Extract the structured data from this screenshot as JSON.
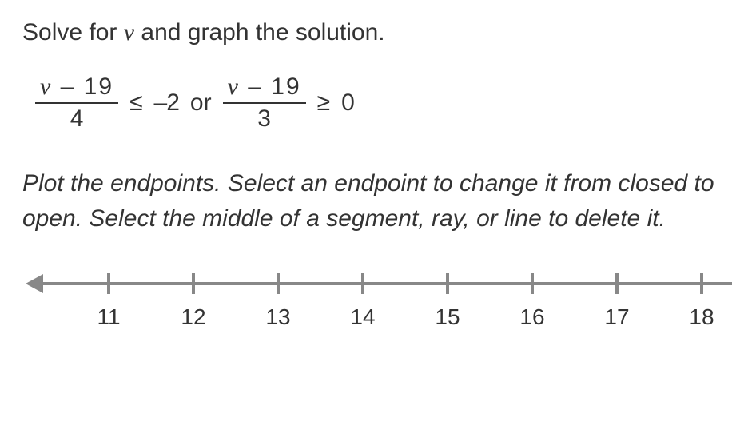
{
  "problem": {
    "prompt_prefix": "Solve for ",
    "prompt_var": "v",
    "prompt_suffix": " and graph the solution."
  },
  "inequality": {
    "frac1_num_var": "v",
    "frac1_num_rest": " – 19",
    "frac1_den": "4",
    "cmp1": "≤",
    "rhs1": "–2",
    "connector": "or",
    "frac2_num_var": "v",
    "frac2_num_rest": " – 19",
    "frac2_den": "3",
    "cmp2": "≥",
    "rhs2": "0"
  },
  "instructions": "Plot the endpoints. Select an endpoint to change it from closed to open. Select the middle of a segment, ray, or line to delete it.",
  "numberline": {
    "ticks": [
      "11",
      "12",
      "13",
      "14",
      "15",
      "16",
      "17",
      "18"
    ]
  },
  "chart_data": {
    "type": "line",
    "title": "Number line",
    "xlabel": "",
    "ylabel": "",
    "categories": [
      11,
      12,
      13,
      14,
      15,
      16,
      17,
      18
    ],
    "values": [
      0,
      0,
      0,
      0,
      0,
      0,
      0,
      0
    ],
    "xlim": [
      10,
      18
    ],
    "ylim": [
      0,
      0
    ]
  }
}
